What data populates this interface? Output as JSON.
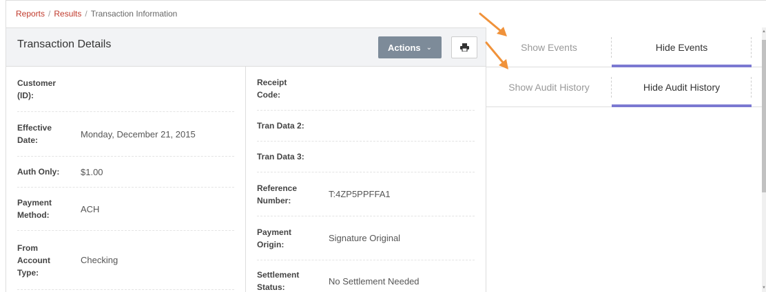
{
  "breadcrumb": {
    "items": [
      "Reports",
      "Results"
    ],
    "separator": "/",
    "current": "Transaction Information"
  },
  "details": {
    "title": "Transaction Details",
    "actions_label": "Actions",
    "actions_icon": "chevron-down-icon",
    "print_icon": "printer-icon",
    "left_fields": [
      {
        "label": "Customer (ID):",
        "value": ""
      },
      {
        "label": "Effective Date:",
        "value": "Monday, December 21, 2015"
      },
      {
        "label": "Auth Only:",
        "value": "$1.00"
      },
      {
        "label": "Payment Method:",
        "value": "ACH"
      },
      {
        "label": "From Account Type:",
        "value": "Checking"
      }
    ],
    "right_fields": [
      {
        "label": "Receipt Code:",
        "value": ""
      },
      {
        "label": "Tran Data 2:",
        "value": ""
      },
      {
        "label": "Tran Data 3:",
        "value": ""
      },
      {
        "label": "Reference Number:",
        "value": "T:4ZP5PPFFA1"
      },
      {
        "label": "Payment Origin:",
        "value": "Signature Original"
      },
      {
        "label": "Settlement Status:",
        "value": "No Settlement Needed"
      }
    ]
  },
  "events_tabs": {
    "show": "Show Events",
    "hide": "Hide Events"
  },
  "audit_tabs": {
    "show": "Show Audit History",
    "hide": "Hide Audit History"
  },
  "colors": {
    "accent": "#7b79d1",
    "breadcrumb_link": "#c0392b",
    "actions_button": "#7d8b99",
    "annotation_arrow": "#f0923a"
  }
}
